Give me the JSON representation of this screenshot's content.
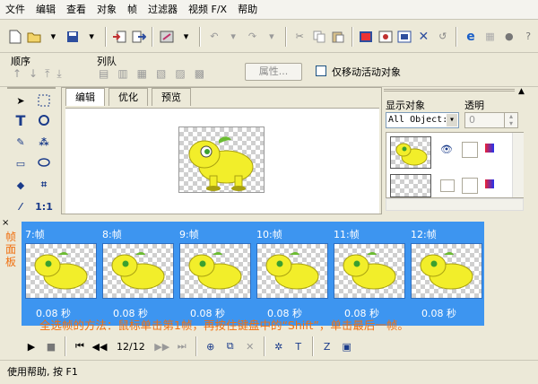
{
  "menu": [
    "文件",
    "编辑",
    "查看",
    "对象",
    "帧",
    "过滤器",
    "视频 F/X",
    "帮助"
  ],
  "order": {
    "label": "顺序",
    "queue_label": "列队",
    "attr_button": "属性...",
    "only_move_label": "仅移动活动对象"
  },
  "tabs": [
    "编辑",
    "优化",
    "预览"
  ],
  "right": {
    "display_label": "显示对象",
    "opacity_label": "透明",
    "display_value": "All Object:",
    "opacity_value": "0"
  },
  "frames_panel_label": "帧面板",
  "frames": [
    {
      "label": "7:帧",
      "duration": "0.08 秒"
    },
    {
      "label": "8:帧",
      "duration": "0.08 秒"
    },
    {
      "label": "9:帧",
      "duration": "0.08 秒"
    },
    {
      "label": "10:帧",
      "duration": "0.08 秒"
    },
    {
      "label": "11:帧",
      "duration": "0.08 秒"
    },
    {
      "label": "12:帧",
      "duration": "0.08 秒"
    }
  ],
  "hint": "全选帧的方法：鼠标单击第1帧，再按住键盘中的“Shift”，单击最后一帧。",
  "frame_counter": "12/12",
  "status": "使用帮助, 按 F1",
  "colors": {
    "accent": "#3d95f0",
    "hint": "#f07010",
    "mascot": "#f2ee2a",
    "mascot_green": "#6cbc32"
  }
}
